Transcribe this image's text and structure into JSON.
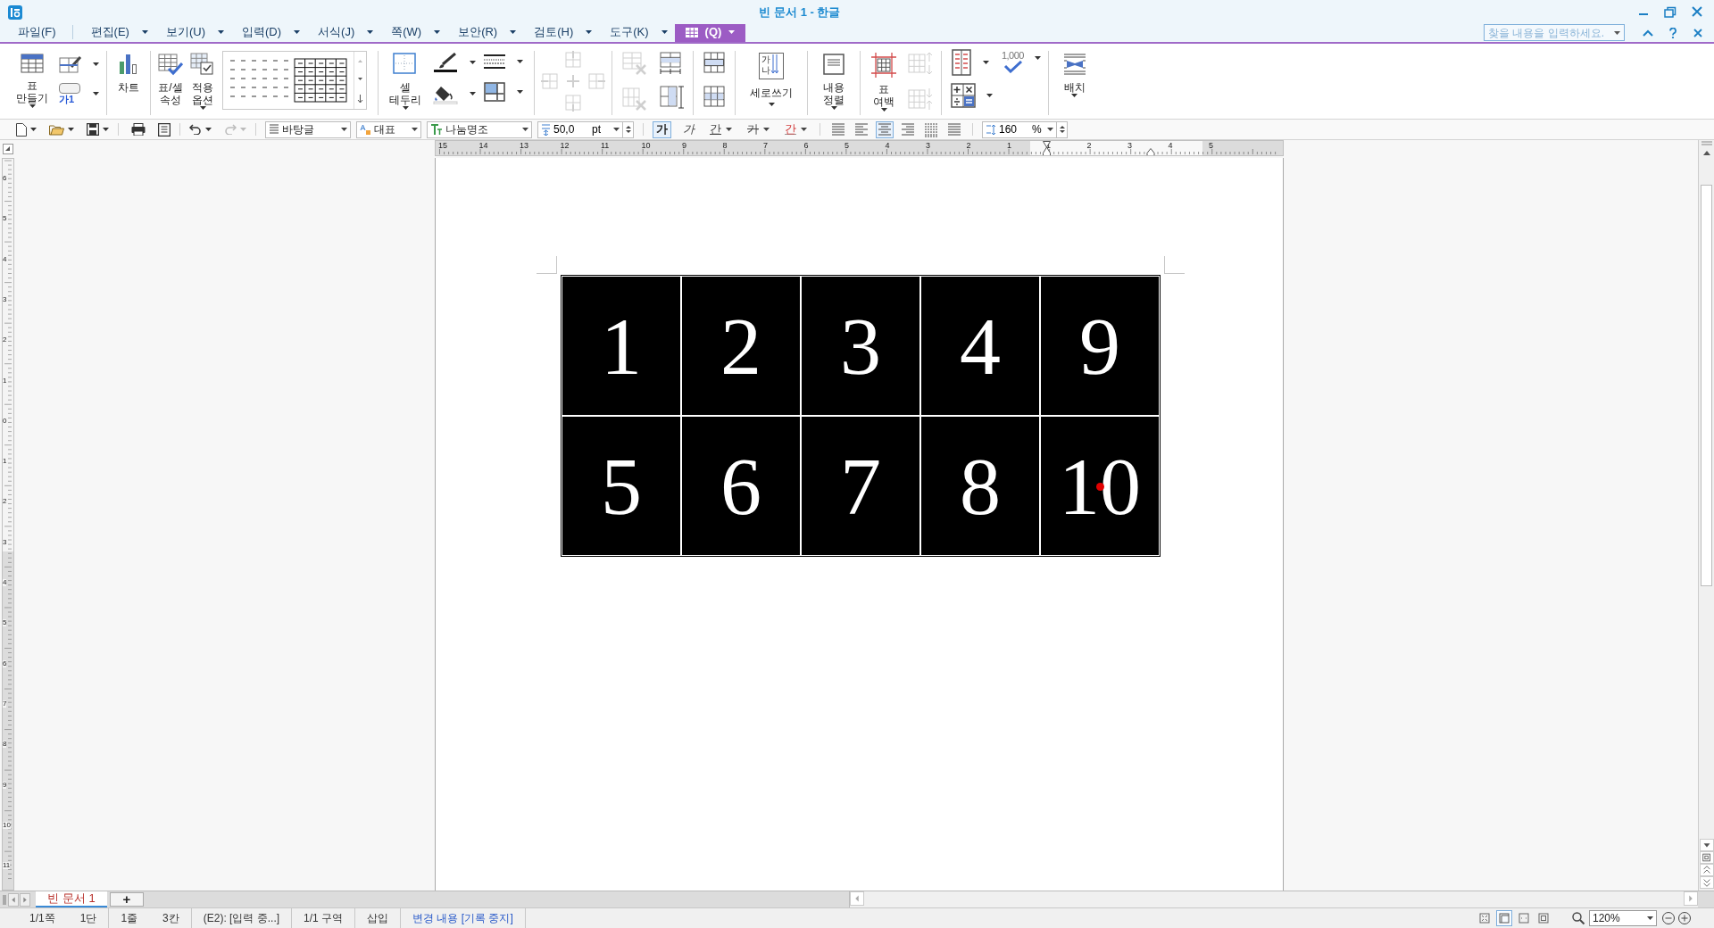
{
  "window": {
    "title": "빈 문서 1 - 한글"
  },
  "menu": [
    {
      "label": "파일(F)",
      "selected": false,
      "dropdown": false
    },
    {
      "label": "편집(E)",
      "selected": false,
      "dropdown": true
    },
    {
      "label": "보기(U)",
      "selected": false,
      "dropdown": true
    },
    {
      "label": "입력(D)",
      "selected": false,
      "dropdown": true
    },
    {
      "label": "서식(J)",
      "selected": false,
      "dropdown": true
    },
    {
      "label": "쪽(W)",
      "selected": false,
      "dropdown": true
    },
    {
      "label": "보안(R)",
      "selected": false,
      "dropdown": true
    },
    {
      "label": "검토(H)",
      "selected": false,
      "dropdown": true
    },
    {
      "label": "도구(K)",
      "selected": false,
      "dropdown": true
    },
    {
      "label": "(Q)",
      "selected": true,
      "dropdown": true,
      "kind": "table"
    }
  ],
  "search": {
    "placeholder": "찾을 내용을 입력하세요."
  },
  "ribbon": {
    "table_create": "표\n만들기",
    "caption": "가1",
    "chart": "차트",
    "table_props": "표/셀\n속성",
    "apply_options": "적용\n옵션",
    "cell_border": "셀\n테두리",
    "vertical_icon": "가\n나",
    "vertical_writing": "세로쓰기",
    "content_align": "내용\n정렬",
    "table_margin": "표\n여백",
    "thousands": "1,000",
    "placement": "배치"
  },
  "toolbar": {
    "para_style": "바탕글",
    "language": "대표",
    "font": "나눔명조",
    "font_size": "50,0",
    "size_unit": "pt",
    "line_spacing": "160",
    "spacing_unit": "%"
  },
  "char_format": [
    {
      "label": "가",
      "kind": "bold",
      "selected": true
    },
    {
      "label": "가",
      "kind": "italic",
      "selected": false
    },
    {
      "label": "간",
      "kind": "underline",
      "selected": false
    },
    {
      "label": "가",
      "kind": "strike",
      "selected": false
    },
    {
      "label": "간",
      "kind": "color",
      "selected": false
    }
  ],
  "alignment": [
    {
      "kind": "justify",
      "selected": false
    },
    {
      "kind": "left",
      "selected": false
    },
    {
      "kind": "center",
      "selected": true
    },
    {
      "kind": "right",
      "selected": false
    },
    {
      "kind": "distribute",
      "selected": false
    },
    {
      "kind": "divide",
      "selected": false
    }
  ],
  "ruler": {
    "left_labels": [
      "15",
      "14",
      "13",
      "12",
      "11",
      "10",
      "9",
      "8",
      "7",
      "6",
      "5",
      "4",
      "3",
      "2",
      "1"
    ],
    "right_labels": [
      "1",
      "2",
      "3",
      "4",
      "5"
    ]
  },
  "vertical_ruler": {
    "labels": [
      "6",
      "5",
      "4",
      "3",
      "2",
      "1",
      "0",
      "1",
      "2",
      "3",
      "4",
      "5",
      "6",
      "7",
      "8",
      "9",
      "10",
      "11"
    ]
  },
  "table": {
    "rows": [
      [
        {
          "text": "1",
          "cursor": false
        },
        {
          "text": "2",
          "cursor": false
        },
        {
          "text": "3",
          "cursor": false
        },
        {
          "text": "4",
          "cursor": false
        },
        {
          "text": "9",
          "cursor": false
        }
      ],
      [
        {
          "text": "5",
          "cursor": false
        },
        {
          "text": "6",
          "cursor": false
        },
        {
          "text": "7",
          "cursor": false
        },
        {
          "text": "8",
          "cursor": false
        },
        {
          "text": "10",
          "cursor": true
        }
      ]
    ]
  },
  "doc_tabs": [
    {
      "label": "빈 문서 1",
      "selected": true
    }
  ],
  "new_tab": "+",
  "status": [
    {
      "kind": "text",
      "items": [
        "1/1쪽",
        "1단"
      ]
    },
    {
      "kind": "text",
      "items": [
        "1줄",
        "3칸"
      ]
    },
    {
      "kind": "text",
      "items": [
        "(E2): [입력 중...]"
      ]
    },
    {
      "kind": "text",
      "items": [
        "1/1 구역"
      ]
    },
    {
      "kind": "text",
      "items": [
        "삽입"
      ]
    },
    {
      "kind": "link",
      "items": [
        "변경 내용 [기록 중지]"
      ]
    }
  ],
  "view_modes": [
    {
      "kind": "fit",
      "selected": false
    },
    {
      "kind": "page",
      "selected": true
    },
    {
      "kind": "width",
      "selected": false
    },
    {
      "kind": "whole",
      "selected": false
    }
  ],
  "zoom": "120%"
}
